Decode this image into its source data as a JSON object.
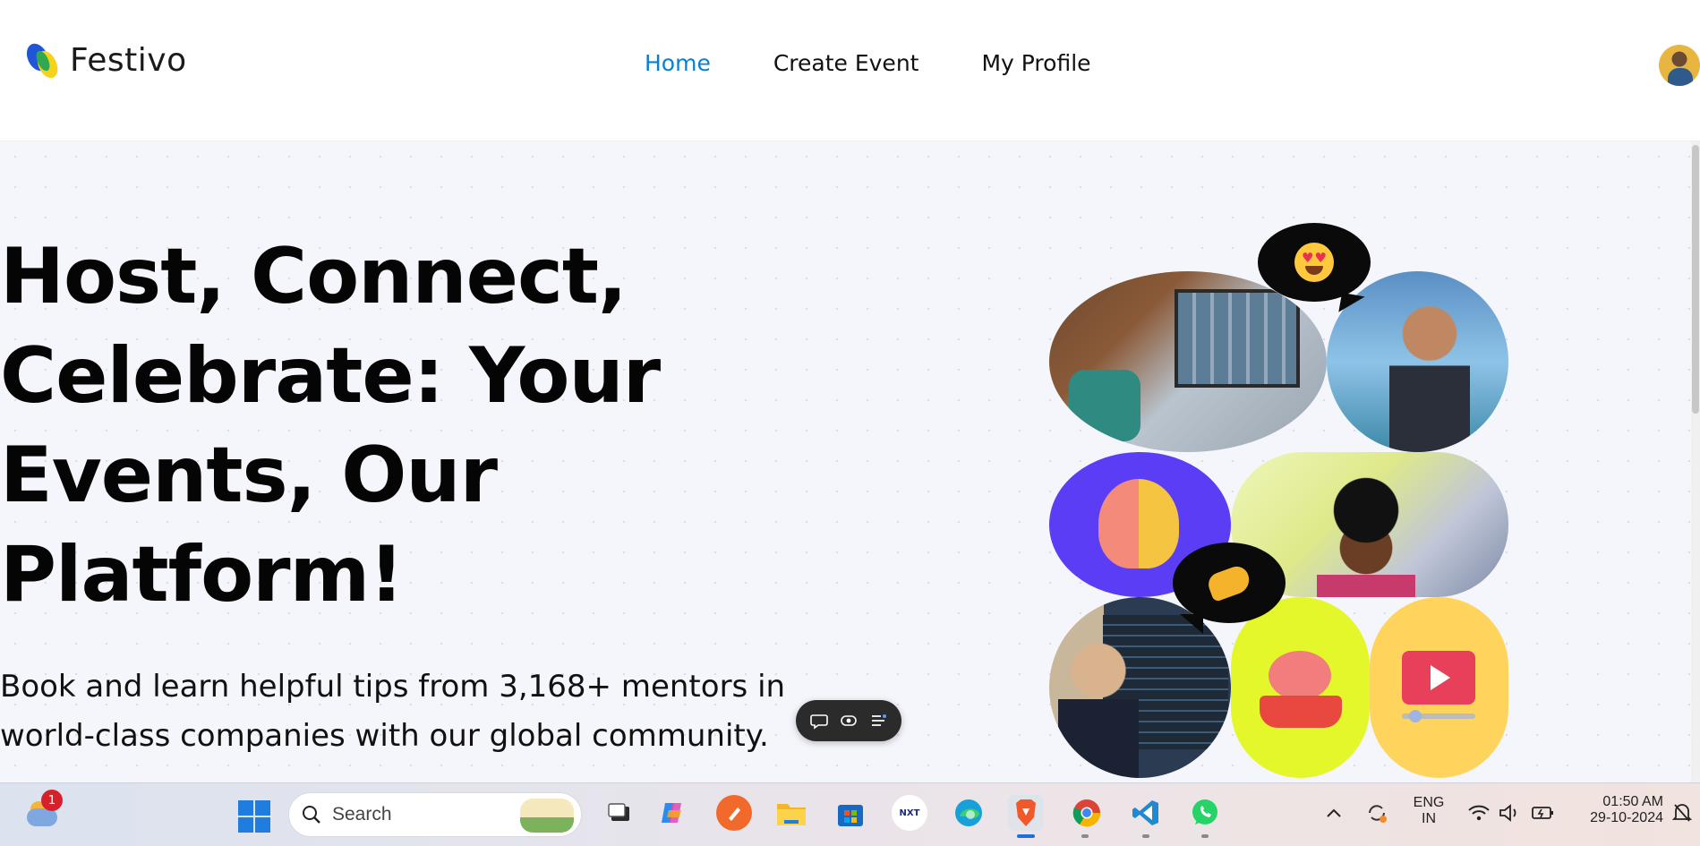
{
  "header": {
    "brand": "Festivo",
    "nav": [
      {
        "label": "Home",
        "active": true
      },
      {
        "label": "Create Event",
        "active": false
      },
      {
        "label": "My Profile",
        "active": false
      }
    ],
    "accent_color": "#0a7fd1"
  },
  "hero": {
    "headline": "Host, Connect, Celebrate: Your Events, Our Platform!",
    "subtext": "Book and learn helpful tips from 3,168+ mentors in world-class companies with our global community."
  },
  "collage": {
    "bubble_love_icon": "heart-eyes-emoji",
    "bubble_hand_icon": "pinching-hand-emoji"
  },
  "floating_toolbar": {
    "icons": [
      "comment-icon",
      "eye-icon",
      "menu-icon"
    ]
  },
  "taskbar": {
    "notification_count": "1",
    "search_placeholder": "Search",
    "apps": [
      "task-view",
      "copilot",
      "pen-app",
      "file-explorer",
      "microsoft-store",
      "nxtwave",
      "edge",
      "brave",
      "chrome",
      "vscode",
      "whatsapp"
    ],
    "language_line1": "ENG",
    "language_line2": "IN",
    "time": "01:50 AM",
    "date": "29-10-2024"
  }
}
